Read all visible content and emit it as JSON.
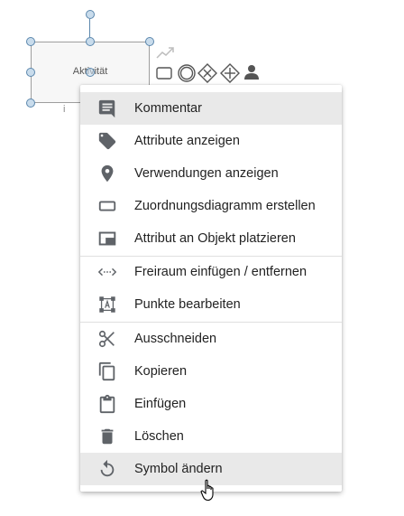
{
  "diagram": {
    "activity_label": "Aktivität",
    "small_marker": "i"
  },
  "colors": {
    "handle_fill": "#c9dcec",
    "handle_stroke": "#5b87ad",
    "icon": "#5f6368",
    "highlight": "#e9e9e9"
  },
  "menu": {
    "items": [
      {
        "icon": "comment-icon",
        "label": "Kommentar"
      },
      {
        "icon": "tag-icon",
        "label": "Attribute anzeigen"
      },
      {
        "icon": "location-pin-icon",
        "label": "Verwendungen anzeigen"
      },
      {
        "icon": "rectangle-icon",
        "label": "Zuordnungsdiagramm erstellen"
      },
      {
        "icon": "picture-in-picture-icon",
        "label": "Attribut an Objekt platzieren"
      },
      {
        "icon": "space-arrows-icon",
        "label": "Freiraum einfügen / entfernen"
      },
      {
        "icon": "edit-points-icon",
        "label": "Punkte bearbeiten"
      },
      {
        "icon": "scissors-icon",
        "label": "Ausschneiden"
      },
      {
        "icon": "copy-icon",
        "label": "Kopieren"
      },
      {
        "icon": "clipboard-icon",
        "label": "Einfügen"
      },
      {
        "icon": "trash-icon",
        "label": "Löschen"
      },
      {
        "icon": "replace-symbol-icon",
        "label": "Symbol ändern"
      }
    ]
  }
}
